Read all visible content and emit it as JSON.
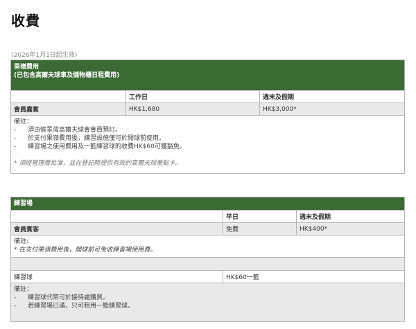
{
  "title": "收費",
  "effective_date": "(2026年1月1日起生效)",
  "green_fee": {
    "header_line1": "果嶺費用",
    "header_line2": "(已包含高爾夫球車及儲物櫃日租費用)",
    "col_weekday": "工作日",
    "col_weekend": "週末及假期",
    "row_label": "會員嘉賓",
    "weekday_price": "HK$1,680",
    "weekend_price": "HK$3,000*",
    "notes_title": "備註：",
    "notes": [
      "須由愉景灣高爾夫球會會員預訂。",
      "於支付果嶺費用後，練習設施僅可於開球前使用。",
      "練習場之使用費用及一籃練習球的收費HK$60可獲豁免。"
    ],
    "footnote": "* 須經管理層批准，並在登記時提供有效的高爾夫球差點卡。"
  },
  "driving_range": {
    "header": "練習場",
    "col_weekday": "平日",
    "col_weekend": "週末及假期",
    "row_label": "會員賓客",
    "weekday_price": "免費",
    "weekend_price": "HK$400*",
    "notes_title": "備註:",
    "note_italic": "* 在支付果嶺費用後，開球前可免收練習場使用費。",
    "balls_label": "練習球",
    "balls_price": "HK$60一籃",
    "balls_notes_title": "備註：",
    "balls_notes": [
      "練習球代幣可於接待處購買。",
      "若練習場已滿，只可租用一籃練習球。"
    ]
  }
}
